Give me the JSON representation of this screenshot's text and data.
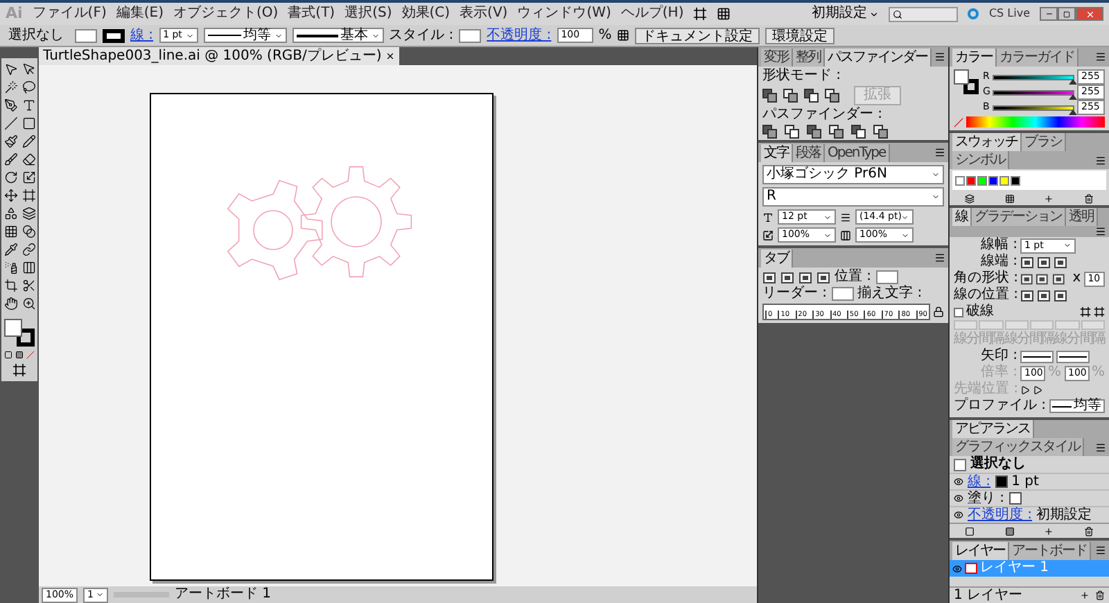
{
  "menu_bar": {
    "logo": "Ai",
    "items": [
      "ファイル(F)",
      "編集(E)",
      "オブジェクト(O)",
      "書式(T)",
      "選択(S)",
      "効果(C)",
      "表示(V)",
      "ウィンドウ(W)",
      "ヘルプ(H)"
    ],
    "workspace": "初期設定",
    "cs_live": "CS Live"
  },
  "control_bar": {
    "selection": "選択なし",
    "stroke_label": "線 :",
    "stroke_weight": "1 pt",
    "profile": "均等",
    "brush": "基本",
    "style_label": "スタイル :",
    "opacity_label": "不透明度 :",
    "opacity": "100",
    "percent": "%",
    "buttons": [
      "ドキュメント設定",
      "環境設定"
    ]
  },
  "document_tab": {
    "title": "TurtleShape003_line.ai @ 100% (RGB/プレビュー)"
  },
  "status_bar": {
    "zoom": "100%",
    "artboard_number": "1",
    "artboard_name": "アートボード 1"
  },
  "pathfinder_panel": {
    "tabs": [
      {
        "label": "変形",
        "selected": false
      },
      {
        "label": "整列",
        "selected": false
      },
      {
        "label": "パスファインダー",
        "selected": true
      }
    ],
    "shape_modes_label": "形状モード :",
    "expand_button": "拡張",
    "pathfinders_label": "パスファインダー :"
  },
  "character_panel": {
    "tabs": [
      {
        "label": "文字",
        "selected": true
      },
      {
        "label": "段落",
        "selected": false
      },
      {
        "label": "OpenType",
        "selected": false
      }
    ],
    "font_family": "小塚ゴシック Pr6N",
    "font_style": "R",
    "font_size": "12 pt",
    "leading": "(14.4 pt)",
    "vertical_scale": "100%",
    "horizontal_scale": "100%"
  },
  "tabs_panel": {
    "tabs": [
      {
        "label": "タブ",
        "selected": true
      }
    ],
    "position_label": "位置 :",
    "leader_label": "リーダー :",
    "align_label": "揃え文字 :",
    "ruler_labels": [
      "0",
      "10",
      "20",
      "30",
      "40",
      "50",
      "60",
      "70",
      "80",
      "90"
    ]
  },
  "color_panel": {
    "tabs": [
      {
        "label": "カラー",
        "selected": true
      },
      {
        "label": "カラーガイド",
        "selected": false
      }
    ],
    "channels": [
      {
        "name": "R",
        "level": 1,
        "reading": "255"
      },
      {
        "name": "G",
        "level": 1,
        "reading": "255"
      },
      {
        "name": "B",
        "level": 1,
        "reading": "255"
      }
    ]
  },
  "swatches_panel": {
    "tabs": [
      {
        "label": "スウォッチ",
        "selected": true
      },
      {
        "label": "ブラシ",
        "selected": false
      },
      {
        "label": "シンボル",
        "selected": false
      }
    ]
  },
  "stroke_panel": {
    "tabs": [
      {
        "label": "線",
        "selected": true
      },
      {
        "label": "グラデーション",
        "selected": false
      },
      {
        "label": "透明",
        "selected": false
      }
    ],
    "weight_label": "線幅 :",
    "weight": "1 pt",
    "cap_label": "線端 :",
    "corner_label": "角の形状 :",
    "limit_sign": "x",
    "limit": "10",
    "align_label": "線の位置 :",
    "dashed": {
      "label": "破線",
      "checked": false
    },
    "dash_labels": [
      "線分",
      "間隔",
      "線分",
      "間隔",
      "線分",
      "間隔"
    ],
    "arrow_label": "矢印 :",
    "scale_label": "倍率 :",
    "scales": [
      {
        "value": "100",
        "unit": "%"
      },
      {
        "value": "100",
        "unit": "%"
      }
    ],
    "arrow_align_label": "先端位置 :",
    "profile_label": "プロファイル :",
    "profile": "均等"
  },
  "appearance_panel": {
    "tabs": [
      {
        "label": "アピアランス",
        "selected": true
      },
      {
        "label": "グラフィックスタイル",
        "selected": false
      }
    ],
    "title": "選択なし",
    "rows": [
      {
        "kind": "stroke",
        "label": "線 :",
        "value": "1 pt"
      },
      {
        "kind": "fill",
        "label": "塗り :"
      },
      {
        "kind": "opacity",
        "label": "不透明度 :",
        "value": "初期設定"
      }
    ]
  },
  "layers_panel": {
    "tabs": [
      {
        "label": "レイヤー",
        "selected": true
      },
      {
        "label": "アートボード",
        "selected": false
      }
    ],
    "layers": [
      {
        "name": "レイヤー 1",
        "selected": true
      }
    ],
    "footer": "1 レイヤー"
  }
}
